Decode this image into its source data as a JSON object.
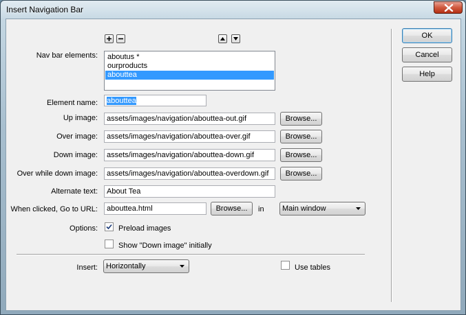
{
  "window": {
    "title": "Insert Navigation Bar"
  },
  "nav_bar": {
    "label": "Nav bar elements:",
    "items": [
      {
        "label": "aboutus *",
        "selected": false
      },
      {
        "label": "ourproducts",
        "selected": false
      },
      {
        "label": "abouttea",
        "selected": true
      }
    ],
    "add_icon": "plus-icon",
    "remove_icon": "minus-icon",
    "up_icon": "arrow-up-icon",
    "down_icon": "arrow-down-icon"
  },
  "fields": {
    "element_name": {
      "label": "Element name:",
      "value": "abouttea"
    },
    "up_image": {
      "label": "Up image:",
      "value": "assets/images/navigation/abouttea-out.gif",
      "browse": "Browse..."
    },
    "over_image": {
      "label": "Over image:",
      "value": "assets/images/navigation/abouttea-over.gif",
      "browse": "Browse..."
    },
    "down_image": {
      "label": "Down image:",
      "value": "assets/images/navigation/abouttea-down.gif",
      "browse": "Browse..."
    },
    "over_while_down": {
      "label": "Over while down image:",
      "value": "assets/images/navigation/abouttea-overdown.gif",
      "browse": "Browse..."
    },
    "alternate_text": {
      "label": "Alternate text:",
      "value": "About Tea"
    },
    "url": {
      "label": "When clicked, Go to URL:",
      "value": "abouttea.html",
      "browse": "Browse...",
      "in_label": "in",
      "target": "Main window"
    }
  },
  "options": {
    "label": "Options:",
    "preload": {
      "label": "Preload images",
      "checked": true
    },
    "show_down": {
      "label": "Show \"Down image\" initially",
      "checked": false
    }
  },
  "insert": {
    "label": "Insert:",
    "value": "Horizontally"
  },
  "use_tables": {
    "label": "Use tables",
    "checked": false
  },
  "buttons": {
    "ok": "OK",
    "cancel": "Cancel",
    "help": "Help"
  },
  "colors": {
    "selection": "#3399ff",
    "close_button": "#c8462a"
  }
}
